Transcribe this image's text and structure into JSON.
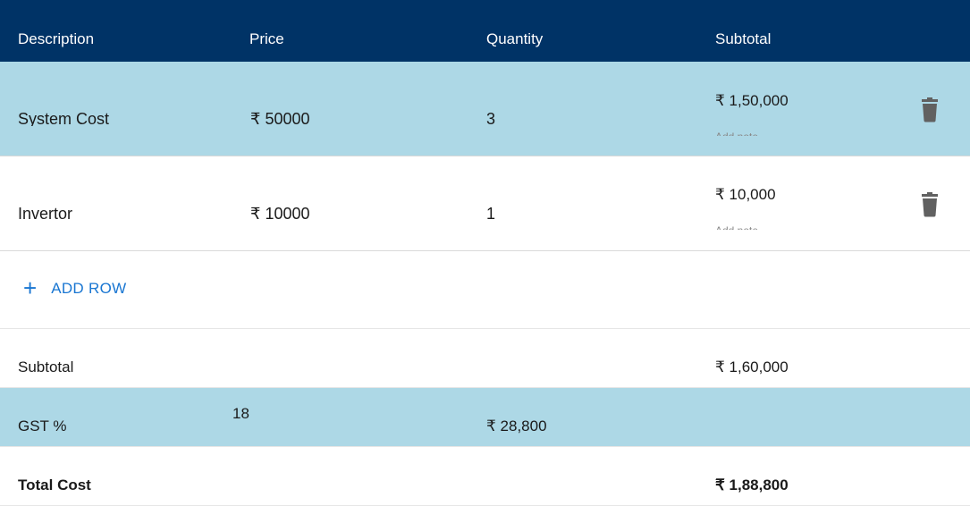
{
  "header": {
    "description": "Description",
    "price": "Price",
    "quantity": "Quantity",
    "subtotal": "Subtotal"
  },
  "items": [
    {
      "description": "System Cost",
      "price": "₹ 50000",
      "quantity": "3",
      "subtotal": "₹ 1,50,000",
      "note_placeholder": "Add note",
      "delete_icon": "trash-icon",
      "selected": true
    },
    {
      "description": "Invertor",
      "price": "₹ 10000",
      "quantity": "1",
      "subtotal": "₹ 10,000",
      "note_placeholder": "Add note",
      "delete_icon": "trash-icon",
      "selected": false
    }
  ],
  "add_row": {
    "icon": "plus-icon",
    "label": "ADD ROW"
  },
  "summary": {
    "subtotal_label": "Subtotal",
    "subtotal_value": "₹ 1,60,000",
    "gst_label": "GST %",
    "gst_input_value": "18",
    "gst_amount": "₹ 28,800",
    "total_label": "Total Cost",
    "total_value": "₹ 1,88,800"
  },
  "colors": {
    "header_bg": "#003366",
    "selected_row_bg": "#add8e6",
    "accent": "#1976d2",
    "icon_gray": "#616161"
  }
}
